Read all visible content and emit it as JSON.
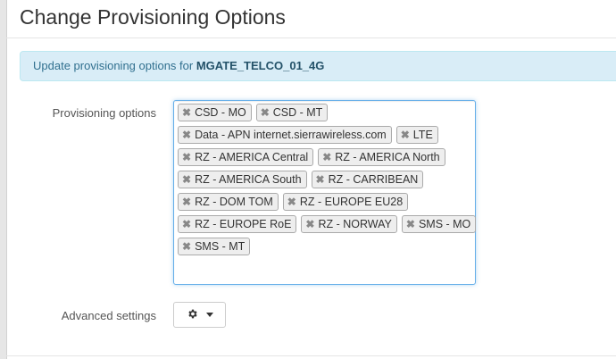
{
  "modal": {
    "title": "Change Provisioning Options"
  },
  "alert": {
    "prefix": "Update provisioning options for ",
    "device_name": "MGATE_TELCO_01_4G"
  },
  "form": {
    "provisioning_label": "Provisioning options",
    "advanced_label": "Advanced settings",
    "remove_glyph": "✖",
    "advanced_button_icon": "gear-icon",
    "selected_options": [
      [
        "CSD - MO",
        "CSD - MT"
      ],
      [
        "Data - APN internet.sierrawireless.com",
        "LTE"
      ],
      [
        "RZ - AMERICA Central",
        "RZ - AMERICA North"
      ],
      [
        "RZ - AMERICA South",
        "RZ - CARRIBEAN"
      ],
      [
        "RZ - DOM TOM",
        "RZ - EUROPE EU28"
      ],
      [
        "RZ - EUROPE RoE",
        "RZ - NORWAY",
        "SMS - MO"
      ],
      [
        "SMS - MT"
      ]
    ]
  },
  "colors": {
    "alert_bg": "#d9edf7",
    "alert_text": "#31708f",
    "focus_border": "#66afe9"
  }
}
